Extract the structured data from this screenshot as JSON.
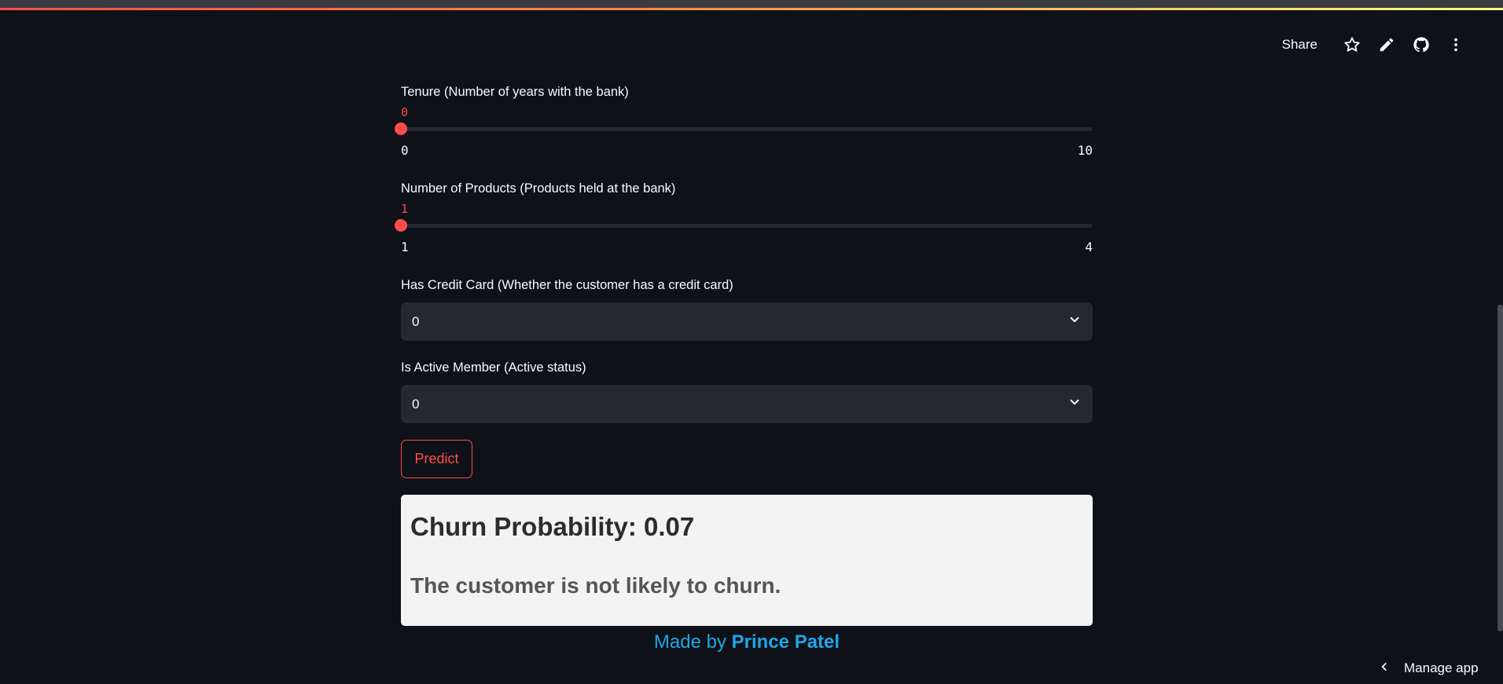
{
  "toolbar": {
    "share_label": "Share",
    "icons": [
      "star-icon",
      "edit-icon",
      "github-icon",
      "more-vertical-icon"
    ]
  },
  "form": {
    "tenure": {
      "label": "Tenure (Number of years with the bank)",
      "value": "0",
      "min": "0",
      "max": "10"
    },
    "num_products": {
      "label": "Number of Products (Products held at the bank)",
      "value": "1",
      "min": "1",
      "max": "4"
    },
    "has_credit_card": {
      "label": "Has Credit Card (Whether the customer has a credit card)",
      "value": "0"
    },
    "is_active_member": {
      "label": "Is Active Member (Active status)",
      "value": "0"
    },
    "predict_label": "Predict"
  },
  "result": {
    "probability_text": "Churn Probability: 0.07",
    "message": "The customer is not likely to churn."
  },
  "footer": {
    "prefix": "Made by",
    "author": "Prince Patel"
  },
  "manage_app": {
    "label": "Manage app"
  },
  "colors": {
    "background": "#0e1117",
    "accent": "#ff4b4b",
    "link": "#1ea7e8",
    "input_bg": "#262730",
    "result_bg": "#f3f3f3"
  }
}
